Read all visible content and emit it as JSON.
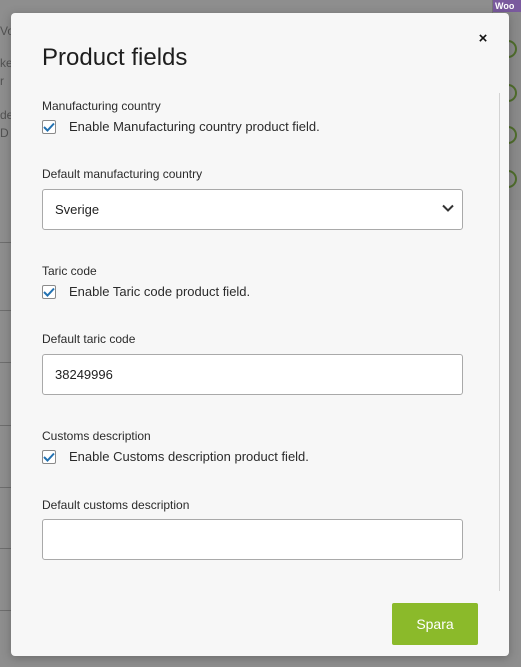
{
  "modal": {
    "title": "Product fields",
    "close_label": "×",
    "save_label": "Spara"
  },
  "sections": {
    "manufacturing": {
      "label": "Manufacturing country",
      "checkbox_label": "Enable Manufacturing country product field.",
      "checked": true,
      "default_label": "Default manufacturing country",
      "default_value": "Sverige"
    },
    "taric": {
      "label": "Taric code",
      "checkbox_label": "Enable Taric code product field.",
      "checked": true,
      "default_label": "Default taric code",
      "default_value": "38249996"
    },
    "customs": {
      "label": "Customs description",
      "checkbox_label": "Enable Customs description product field.",
      "checked": true,
      "default_label": "Default customs description",
      "default_value": ""
    }
  },
  "background": {
    "fragments": [
      "Vo",
      "ke",
      "r",
      "de",
      "D"
    ],
    "logo_text": "Woo"
  },
  "colors": {
    "accent_check": "#2271b1",
    "save_button": "#8bba2a"
  }
}
